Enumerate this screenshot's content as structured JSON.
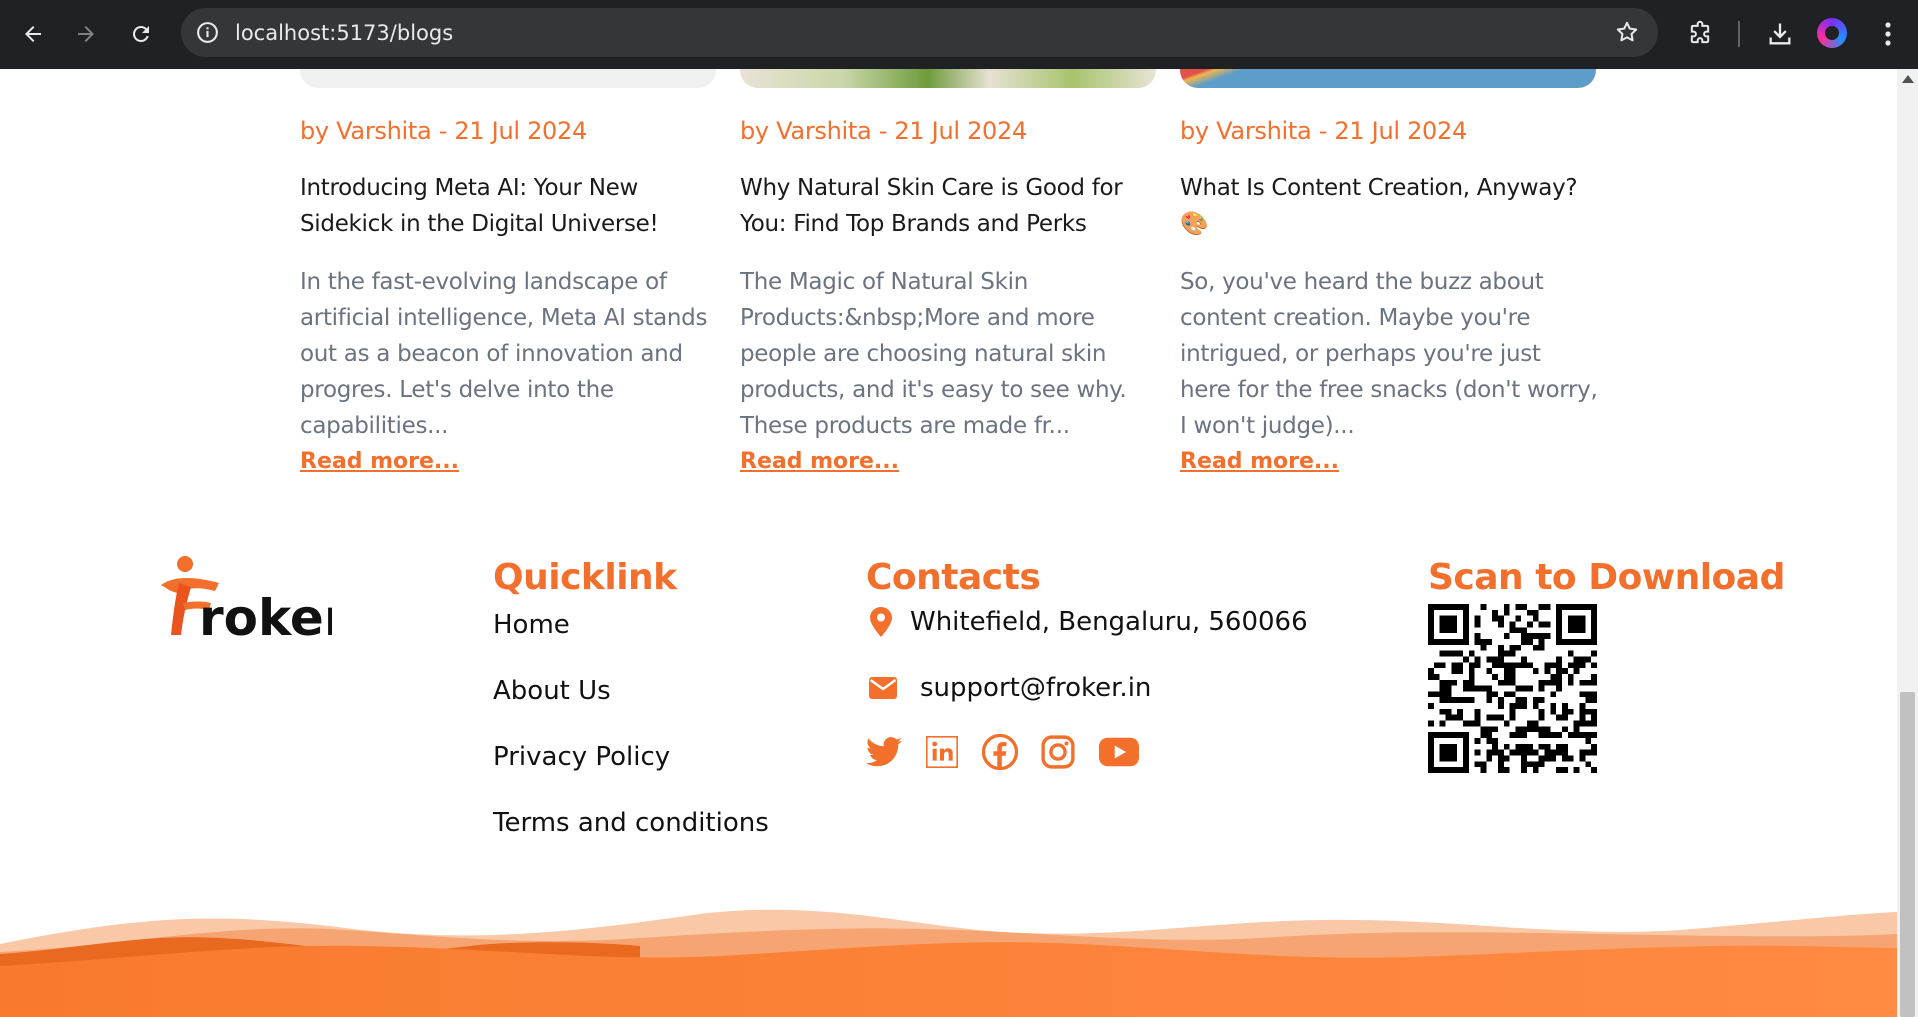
{
  "browser": {
    "url": "localhost:5173/blogs"
  },
  "colors": {
    "accent": "#f26f2c",
    "chrome_bg": "#202124",
    "text_muted": "#6b7280"
  },
  "blogs": [
    {
      "byline": "by Varshita - 21 Jul 2024",
      "title": "Introducing Meta AI: Your New Sidekick in the Digital Universe!",
      "excerpt": "In the fast-evolving landscape of artificial intelligence, Meta AI stands out as a beacon of innovation and progres. Let's delve into the capabilities...",
      "read_more": "Read more..."
    },
    {
      "byline": "by Varshita - 21 Jul 2024",
      "title": "Why Natural Skin Care is Good for You: Find Top Brands and Perks",
      "excerpt": "The Magic of Natural Skin Products:&nbsp;More and more people are choosing natural skin products, and it's easy to see why. These products are made fr...",
      "read_more": "Read more..."
    },
    {
      "byline": "by Varshita - 21 Jul 2024",
      "title": "What Is Content Creation, Anyway? 🎨",
      "excerpt": "So, you've heard the buzz about content creation. Maybe you're intrigued, or perhaps you're just here for the free snacks (don't worry, I won't judge)...",
      "read_more": "Read more..."
    }
  ],
  "footer": {
    "logo_text": "roker",
    "quicklink": {
      "heading": "Quicklink",
      "links": [
        "Home",
        "About Us",
        "Privacy Policy",
        "Terms and conditions"
      ]
    },
    "contacts": {
      "heading": "Contacts",
      "address": "Whitefield, Bengaluru, 560066",
      "email": "support@froker.in",
      "socials": [
        "twitter-icon",
        "linkedin-icon",
        "facebook-icon",
        "instagram-icon",
        "youtube-icon"
      ]
    },
    "download": {
      "heading": "Scan to Download"
    }
  }
}
